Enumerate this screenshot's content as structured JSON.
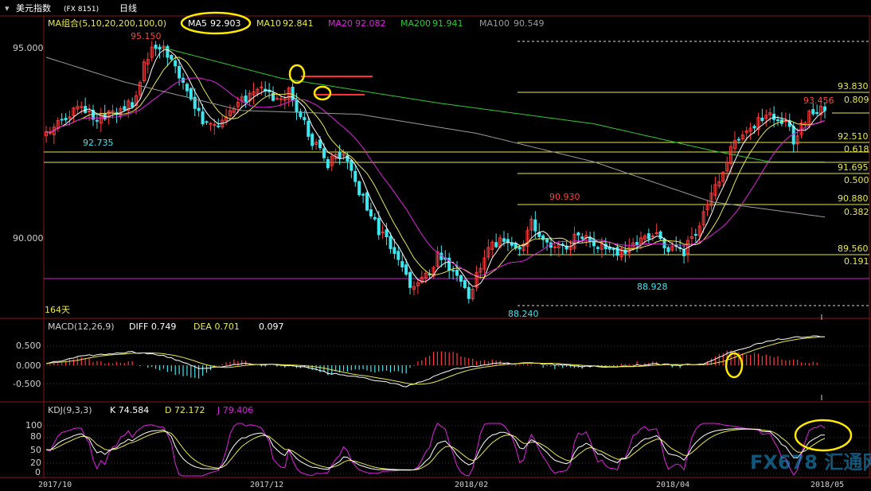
{
  "window": {
    "title": "美元指数",
    "symbol": "(FX 8151)",
    "period": "日线",
    "menu_caret": "▾"
  },
  "colors": {
    "background": "#000000",
    "grid": "#8a1414",
    "axis_text": "#cfcfcf",
    "up": "#ff3b3b",
    "down": "#3ee6f0",
    "ma5": "#ffffff",
    "ma10": "#e8e84a",
    "ma20": "#e020e0",
    "ma200": "#30c830",
    "ma100": "#9a9a9a",
    "fib": "#e8e84a",
    "highlight_circle": "#ffea00",
    "magenta_line": "#d020d0",
    "red_mark": "#ff3030",
    "watermark": "#1f9adb"
  },
  "main_panel": {
    "indicator_label": "MA组合(5,10,20,200,100,0)",
    "ma": [
      {
        "name": "MA5",
        "value": "92.903"
      },
      {
        "name": "MA10",
        "value": "92.841"
      },
      {
        "name": "MA20",
        "value": "92.082"
      },
      {
        "name": "MA200",
        "value": "91.941"
      },
      {
        "name": "MA100",
        "value": "90.549"
      }
    ],
    "y_ticks": [
      "95.000",
      "90.000"
    ],
    "bars_label": "164天",
    "annotations": [
      {
        "text": "95.150",
        "color": "red"
      },
      {
        "text": "92.735",
        "color": "cyan"
      },
      {
        "text": "90.930",
        "color": "red"
      },
      {
        "text": "88.928",
        "color": "cyan"
      },
      {
        "text": "88.240",
        "color": "cyan"
      },
      {
        "text": "93.456",
        "color": "red"
      }
    ],
    "fib_levels": [
      {
        "price": "93.830",
        "ratio": "0.809"
      },
      {
        "price": "92.510",
        "ratio": "0.618"
      },
      {
        "price": "91.695",
        "ratio": "0.500"
      },
      {
        "price": "90.880",
        "ratio": "0.382"
      },
      {
        "price": "89.560",
        "ratio": "0.191"
      }
    ]
  },
  "macd_panel": {
    "label": "MACD(12,26,9)",
    "diff": "DIFF 0.749",
    "dea": "DEA 0.701",
    "macd": "0.097",
    "y_ticks": [
      "0.500",
      "0.000",
      "-0.500"
    ]
  },
  "kdj_panel": {
    "label": "KDJ(9,3,3)",
    "k": "K 74.584",
    "d": "D 72.172",
    "j": "J 79.406",
    "y_ticks": [
      "100",
      "80",
      "50",
      "20",
      "0"
    ]
  },
  "x_axis": {
    "ticks": [
      "2017/10",
      "2017/12",
      "2018/02",
      "2018/04",
      "2018/05"
    ]
  },
  "watermark": "FX678 汇通网",
  "chart_data": {
    "type": "candlestick",
    "title": "美元指数 (FX 8151) 日线",
    "bars": 200,
    "ylim": [
      87.95,
      96.0
    ],
    "candle_anchors": [
      [
        0,
        92.75
      ],
      [
        8,
        93.35
      ],
      [
        14,
        93.15
      ],
      [
        22,
        93.55
      ],
      [
        27,
        95.15
      ],
      [
        31,
        94.85
      ],
      [
        36,
        93.9
      ],
      [
        40,
        93.1
      ],
      [
        44,
        93.05
      ],
      [
        48,
        93.45
      ],
      [
        55,
        94.05
      ],
      [
        60,
        93.55
      ],
      [
        62,
        93.9
      ],
      [
        68,
        92.55
      ],
      [
        72,
        91.95
      ],
      [
        76,
        92.3
      ],
      [
        83,
        90.5
      ],
      [
        88,
        89.8
      ],
      [
        93,
        88.7
      ],
      [
        98,
        89.0
      ],
      [
        100,
        89.5
      ],
      [
        106,
        88.9
      ],
      [
        108,
        88.5
      ],
      [
        112,
        89.6
      ],
      [
        116,
        89.9
      ],
      [
        121,
        89.6
      ],
      [
        124,
        90.45
      ],
      [
        128,
        89.8
      ],
      [
        132,
        89.7
      ],
      [
        136,
        90.05
      ],
      [
        140,
        89.85
      ],
      [
        144,
        89.6
      ],
      [
        148,
        89.6
      ],
      [
        152,
        90.0
      ],
      [
        156,
        90.0
      ],
      [
        160,
        89.7
      ],
      [
        163,
        89.6
      ],
      [
        167,
        90.4
      ],
      [
        171,
        91.3
      ],
      [
        176,
        92.6
      ],
      [
        180,
        92.95
      ],
      [
        185,
        93.2
      ],
      [
        189,
        93.1
      ],
      [
        191,
        92.55
      ],
      [
        194,
        93.1
      ],
      [
        197,
        93.4
      ],
      [
        199,
        93.35
      ]
    ],
    "macd_anchors": [
      [
        0,
        0.05
      ],
      [
        10,
        0.25
      ],
      [
        22,
        0.35
      ],
      [
        30,
        0.25
      ],
      [
        40,
        -0.1
      ],
      [
        50,
        0.05
      ],
      [
        60,
        0.0
      ],
      [
        65,
        -0.02
      ],
      [
        72,
        -0.2
      ],
      [
        82,
        -0.35
      ],
      [
        92,
        -0.55
      ],
      [
        98,
        -0.35
      ],
      [
        104,
        -0.1
      ],
      [
        115,
        0.05
      ],
      [
        125,
        0.05
      ],
      [
        135,
        -0.02
      ],
      [
        145,
        -0.05
      ],
      [
        155,
        0.03
      ],
      [
        162,
        0.0
      ],
      [
        168,
        0.05
      ],
      [
        175,
        0.35
      ],
      [
        185,
        0.65
      ],
      [
        192,
        0.75
      ],
      [
        199,
        0.75
      ]
    ]
  }
}
